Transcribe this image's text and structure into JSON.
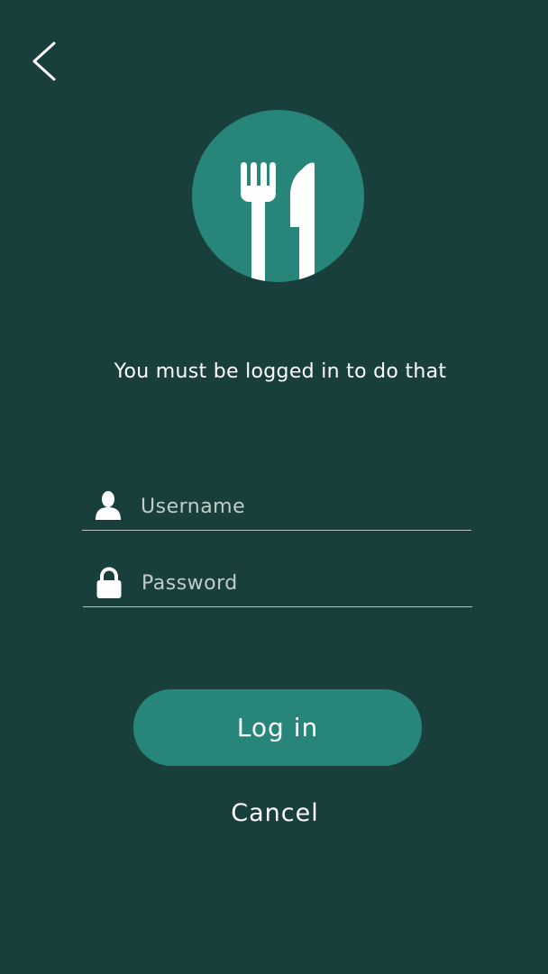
{
  "header": {
    "back_icon": "chevron-left-icon"
  },
  "logo": {
    "icon": "fork-knife-icon",
    "circle_color": "#27857a"
  },
  "message": {
    "text": "You must be logged in to do that"
  },
  "form": {
    "username": {
      "icon": "user-icon",
      "placeholder": "Username",
      "value": ""
    },
    "password": {
      "icon": "lock-icon",
      "placeholder": "Password",
      "value": ""
    }
  },
  "actions": {
    "login_label": "Log in",
    "cancel_label": "Cancel"
  },
  "colors": {
    "background": "#193f3c",
    "accent": "#27857a",
    "text": "#ffffff",
    "divider": "#b8c4c2"
  }
}
